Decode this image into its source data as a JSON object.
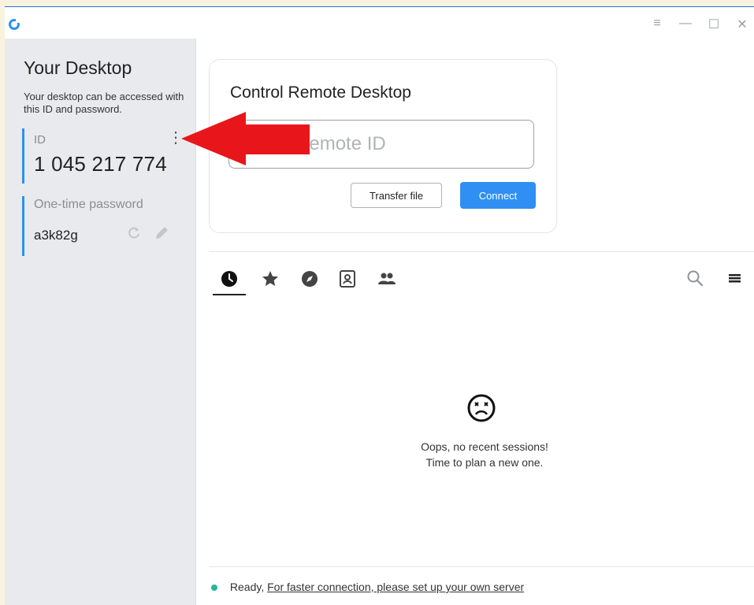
{
  "window": {
    "controls": [
      "≡",
      "—",
      "☐",
      "✕"
    ],
    "accent_color": "#2f8ff3"
  },
  "sidebar": {
    "title": "Your Desktop",
    "description": "Your desktop can be accessed with this ID and password.",
    "id_label": "ID",
    "id_value": "1 045 217 774",
    "password_label": "One-time password",
    "password_value": "a3k82g"
  },
  "remote": {
    "title": "Control Remote Desktop",
    "input_placeholder": "Enter Remote ID",
    "input_value": "",
    "transfer_label": "Transfer file",
    "connect_label": "Connect"
  },
  "tabs": [
    {
      "icon": "clock-icon",
      "name": "recent-sessions",
      "active": true
    },
    {
      "icon": "star-icon",
      "name": "favorites",
      "active": false
    },
    {
      "icon": "compass-icon",
      "name": "discovered",
      "active": false
    },
    {
      "icon": "address-book-icon",
      "name": "address-book",
      "active": false
    },
    {
      "icon": "group-icon",
      "name": "group",
      "active": false
    }
  ],
  "empty_state": {
    "line1": "Oops, no recent sessions!",
    "line2": "Time to plan a new one."
  },
  "status": {
    "ready": "Ready,",
    "link": "For faster connection, please set up your own server",
    "dot_color": "#28b59c"
  },
  "annotation": {
    "arrow_color": "#e8161b"
  }
}
